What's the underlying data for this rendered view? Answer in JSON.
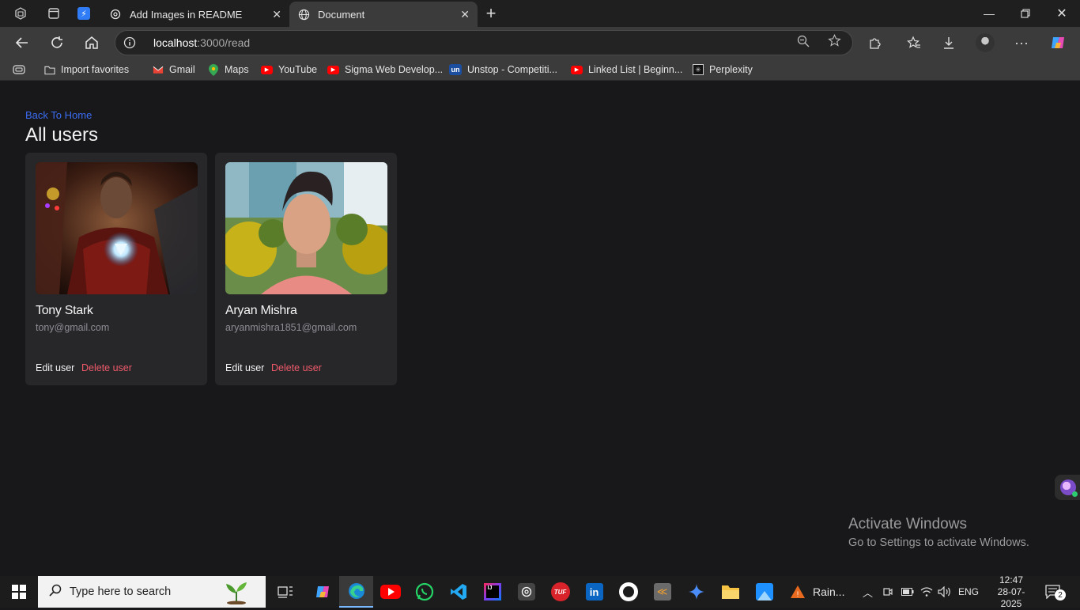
{
  "browser": {
    "tabs": [
      {
        "title": "Add Images in README",
        "icon": "openai-icon"
      },
      {
        "title": "Document",
        "icon": "globe-icon"
      }
    ],
    "address": {
      "host": "localhost",
      "path": ":3000/read"
    },
    "favorites": [
      {
        "label": "Import favorites"
      },
      {
        "label": "Gmail"
      },
      {
        "label": "Maps"
      },
      {
        "label": "YouTube"
      },
      {
        "label": "Sigma Web Develop..."
      },
      {
        "label": "Unstop - Competiti..."
      },
      {
        "label": "Linked List | Beginn..."
      },
      {
        "label": "Perplexity"
      }
    ]
  },
  "page": {
    "back_link": "Back To Home",
    "title": "All users",
    "users": [
      {
        "name": "Tony Stark",
        "email": "tony@gmail.com",
        "edit_label": "Edit user",
        "delete_label": "Delete user"
      },
      {
        "name": "Aryan Mishra",
        "email": "aryanmishra1851@gmail.com",
        "edit_label": "Edit user",
        "delete_label": "Delete user"
      }
    ]
  },
  "watermark": {
    "line1": "Activate Windows",
    "line2": "Go to Settings to activate Windows."
  },
  "taskbar": {
    "search_placeholder": "Type here to search",
    "weather": "Rain...",
    "language": "ENG",
    "time": "12:47",
    "date": "28-07-2025",
    "notifications": "2"
  },
  "colors": {
    "accent_link": "#3b6cf0",
    "delete": "#ef5a6a",
    "card_bg": "#27272a",
    "page_bg": "#18181b"
  }
}
